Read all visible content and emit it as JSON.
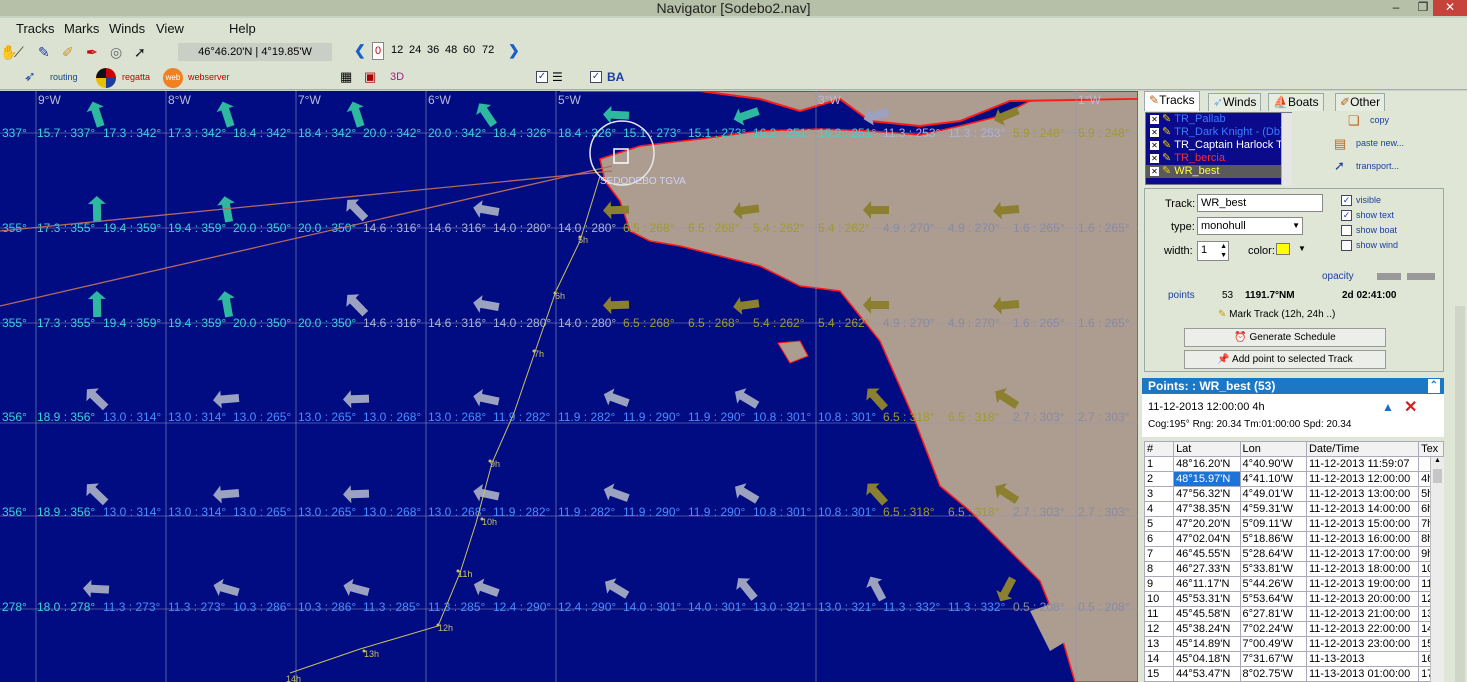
{
  "window": {
    "title": "Navigator [Sodebo2.nav]"
  },
  "menu": [
    "Tracks",
    "Marks",
    "Winds",
    "View",
    "Help"
  ],
  "toolbar": {
    "coords": "46°46.20'N | 4°19.85'W",
    "hours": [
      "0",
      "12",
      "24",
      "36",
      "48",
      "60",
      "72"
    ],
    "routing": "routing",
    "regatta": "regatta",
    "webserver": "webserver",
    "three_d": "3D",
    "ba": "BA"
  },
  "map": {
    "lon_labels": [
      "9°W",
      "8°W",
      "7°W",
      "6°W",
      "5°W",
      "3°W",
      "1°W"
    ],
    "wind_rows": [
      [
        "337°",
        "15.7 : 337°",
        "17.3 : 342°",
        "17.3 : 342°",
        "18.4 : 342°",
        "18.4 : 342°",
        "20.0 : 342°",
        "20.0 : 342°",
        "18.4 : 326°",
        "18.4 : 326°",
        "15.1 : 273°",
        "15.1 : 273°",
        "16.2 : 251°",
        "16.2 : 251°",
        "11.3 : 253°",
        "11.3 : 253°",
        "5.9 : 248°",
        "5.9 : 248°"
      ],
      [
        "355°",
        "17.3 : 355°",
        "19.4 : 359°",
        "19.4 : 359°",
        "20.0 : 350°",
        "20.0 : 350°",
        "14.6 : 316°",
        "14.6 : 316°",
        "14.0 : 280°",
        "14.0 : 280°",
        "6.5 : 268°",
        "6.5 : 268°",
        "5.4 : 262°",
        "5.4 : 262°",
        "4.9 : 270°",
        "4.9 : 270°",
        "1.6 : 265°",
        "1.6 : 265°"
      ],
      [
        "355°",
        "17.3 : 355°",
        "19.4 : 359°",
        "19.4 : 359°",
        "20.0 : 350°",
        "20.0 : 350°",
        "14.6 : 316°",
        "14.6 : 316°",
        "14.0 : 280°",
        "14.0 : 280°",
        "6.5 : 268°",
        "6.5 : 268°",
        "5.4 : 262°",
        "5.4 : 262°",
        "4.9 : 270°",
        "4.9 : 270°",
        "1.6 : 265°",
        "1.6 : 265°"
      ],
      [
        "356°",
        "18.9 : 356°",
        "13.0 : 314°",
        "13.0 : 314°",
        "13.0 : 265°",
        "13.0 : 265°",
        "13.0 : 268°",
        "13.0 : 268°",
        "11.9 : 282°",
        "11.9 : 282°",
        "11.9 : 290°",
        "11.9 : 290°",
        "10.8 : 301°",
        "10.8 : 301°",
        "6.5 : 318°",
        "6.5 : 318°",
        "2.7 : 303°",
        "2.7 : 303°"
      ],
      [
        "356°",
        "18.9 : 356°",
        "13.0 : 314°",
        "13.0 : 314°",
        "13.0 : 265°",
        "13.0 : 265°",
        "13.0 : 268°",
        "13.0 : 268°",
        "11.9 : 282°",
        "11.9 : 282°",
        "11.9 : 290°",
        "11.9 : 290°",
        "10.8 : 301°",
        "10.8 : 301°",
        "6.5 : 318°",
        "6.5 : 318°",
        "2.7 : 303°",
        "2.7 : 303°"
      ],
      [
        "278°",
        "18.0 : 278°",
        "11.3 : 273°",
        "11.3 : 273°",
        "10.3 : 286°",
        "10.3 : 286°",
        "11.3 : 285°",
        "11.3 : 285°",
        "12.4 : 290°",
        "12.4 : 290°",
        "14.0 : 301°",
        "14.0 : 301°",
        "13.0 : 321°",
        "13.0 : 321°",
        "11.3 : 332°",
        "11.3 : 332°",
        "0.5 : 208°",
        "0.5 : 208°"
      ]
    ],
    "track_hours": [
      "5h",
      "6h",
      "7h",
      "9h",
      "10h",
      "11h",
      "12h",
      "13h",
      "14h"
    ],
    "boat_label": "SEDODEBO TGVA"
  },
  "panel": {
    "tabs": [
      "Tracks",
      "Winds",
      "Boats",
      "Other"
    ],
    "track_list": [
      {
        "name": "TR_Pallab",
        "color": "#3a7bff"
      },
      {
        "name": "TR_Dark Knight - (Db)",
        "color": "#3a7bff"
      },
      {
        "name": "TR_Captain Harlock TG",
        "color": "#ffffff"
      },
      {
        "name": "TR_bercia",
        "color": "#ff2a2a"
      },
      {
        "name": "WR_best",
        "color": "#ffff40"
      }
    ],
    "copy": "copy",
    "paste": "paste new...",
    "transport": "transport...",
    "track_label": "Track:",
    "track_value": "WR_best",
    "type_label": "type:",
    "type_value": "monohull",
    "width_label": "width:",
    "width_value": "1",
    "color_label": "color:",
    "color_value": "#ffff00",
    "visible": "visible",
    "show_text": "show text",
    "show_boat": "show boat",
    "show_wind": "show wind",
    "opacity": "opacity",
    "points_label": "points",
    "points_value": "53",
    "distance": "1191.7°NM",
    "duration": "2d 02:41:00",
    "mark_track": "Mark Track (12h, 24h ..)",
    "generate_schedule": "Generate Schedule",
    "add_point": "Add point to selected Track",
    "points_title": "Points: : WR_best (53)",
    "point_time": "11-12-2013 12:00:00 4h",
    "point_info": "Cog:195° Rng: 20.34 Tm:01:00:00 Spd: 20.34",
    "table_headers": [
      "#",
      "Lat",
      "Lon",
      "Date/Time",
      "Tex"
    ],
    "table_rows": [
      [
        "1",
        "48°16.20'N",
        "4°40.90'W",
        "11-12-2013 11:59:07",
        ""
      ],
      [
        "2",
        "48°15.97'N",
        "4°41.10'W",
        "11-12-2013 12:00:00",
        "4h"
      ],
      [
        "3",
        "47°56.32'N",
        "4°49.01'W",
        "11-12-2013 13:00:00",
        "5h"
      ],
      [
        "4",
        "47°38.35'N",
        "4°59.31'W",
        "11-12-2013 14:00:00",
        "6h"
      ],
      [
        "5",
        "47°20.20'N",
        "5°09.11'W",
        "11-12-2013 15:00:00",
        "7h"
      ],
      [
        "6",
        "47°02.04'N",
        "5°18.86'W",
        "11-12-2013 16:00:00",
        "8h"
      ],
      [
        "7",
        "46°45.55'N",
        "5°28.64'W",
        "11-12-2013 17:00:00",
        "9h"
      ],
      [
        "8",
        "46°27.33'N",
        "5°33.81'W",
        "11-12-2013 18:00:00",
        "10h"
      ],
      [
        "9",
        "46°11.17'N",
        "5°44.26'W",
        "11-12-2013 19:00:00",
        "11h"
      ],
      [
        "10",
        "45°53.31'N",
        "5°53.64'W",
        "11-12-2013 20:00:00",
        "12h"
      ],
      [
        "11",
        "45°45.58'N",
        "6°27.81'W",
        "11-12-2013 21:00:00",
        "13h"
      ],
      [
        "12",
        "45°38.24'N",
        "7°02.24'W",
        "11-12-2013 22:00:00",
        "14h"
      ],
      [
        "13",
        "45°14.89'N",
        "7°00.49'W",
        "11-12-2013 23:00:00",
        "15h"
      ],
      [
        "14",
        "45°04.18'N",
        "7°31.67'W",
        "11-13-2013",
        "16h"
      ],
      [
        "15",
        "44°53.47'N",
        "8°02.75'W",
        "11-13-2013 01:00:00",
        "17h"
      ]
    ]
  }
}
